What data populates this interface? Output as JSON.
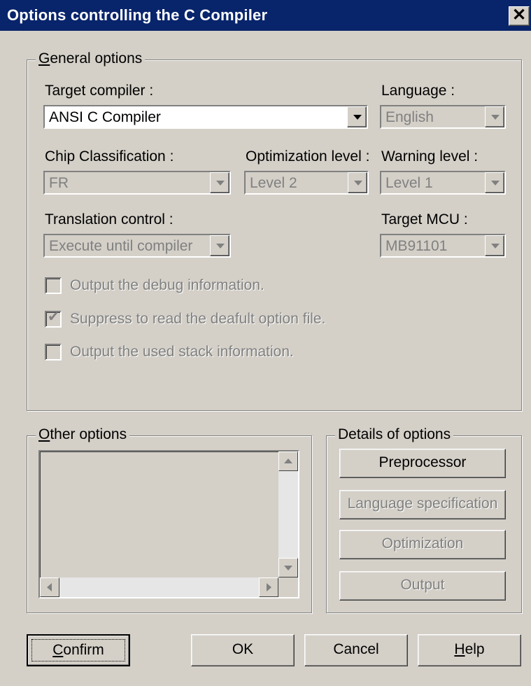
{
  "window": {
    "title": "Options controlling the C Compiler",
    "close_glyph": "✕"
  },
  "general": {
    "legend_mnemonic": "G",
    "legend_rest": "eneral options",
    "target_compiler_label": "Target compiler :",
    "target_compiler_value": "ANSI C Compiler",
    "language_label": "Language :",
    "language_value": "English",
    "chip_label": "Chip Classification :",
    "chip_value": "FR",
    "optimization_label": "Optimization level :",
    "optimization_value": "Level 2",
    "warning_label": "Warning level :",
    "warning_value": "Level 1",
    "translation_label": "Translation control :",
    "translation_value": "Execute until compiler",
    "mcu_label": "Target MCU :",
    "mcu_value": "MB91101",
    "checkboxes": [
      {
        "label": "Output the debug information.",
        "checked": false
      },
      {
        "label": "Suppress to read the deafult option file.",
        "checked": true
      },
      {
        "label": "Output the used stack information.",
        "checked": false
      }
    ]
  },
  "other": {
    "legend_mnemonic": "O",
    "legend_rest": "ther options"
  },
  "details": {
    "legend": "Details of options",
    "buttons": [
      "Preprocessor",
      "Language specification",
      "Optimization",
      "Output"
    ]
  },
  "footer": {
    "confirm_mnemonic": "C",
    "confirm_rest": "onfirm",
    "ok": "OK",
    "cancel": "Cancel",
    "help_mnemonic": "H",
    "help_rest": "elp"
  }
}
